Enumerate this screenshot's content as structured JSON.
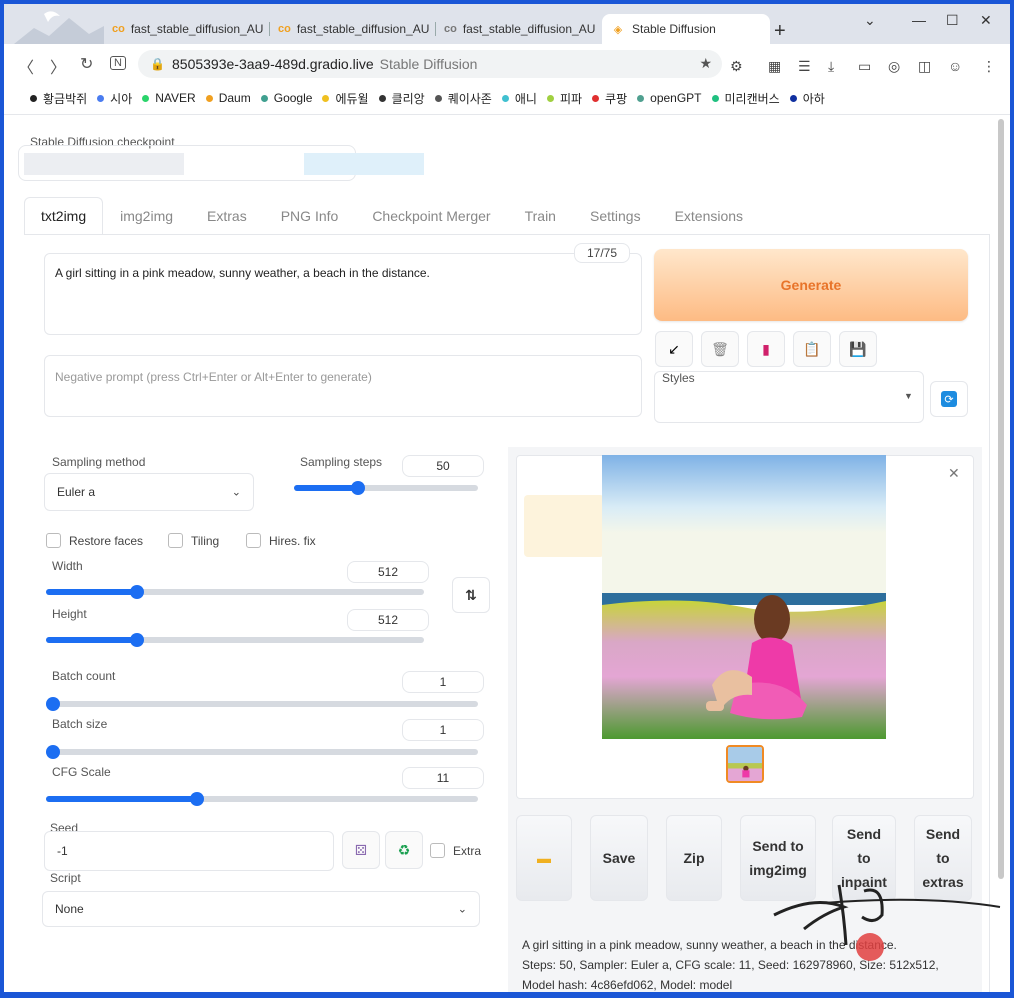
{
  "browser": {
    "tabs": [
      {
        "title": "fast_stable_diffusion_AU",
        "icon": "colab-icon"
      },
      {
        "title": "fast_stable_diffusion_AU",
        "icon": "colab-icon"
      },
      {
        "title": "fast_stable_diffusion_AU",
        "icon": "colab-icon"
      },
      {
        "title": "Stable Diffusion",
        "icon": "gradio-icon",
        "active": true
      }
    ],
    "new_tab": "+",
    "url": "8505393e-3aa9-489d.gradio.live",
    "page_title": "Stable Diffusion",
    "bookmarks": [
      {
        "label": "황금박쥐",
        "color": "#222222"
      },
      {
        "label": "시아",
        "color": "#4a7cf0"
      },
      {
        "label": "NAVER",
        "color": "#2bd46b"
      },
      {
        "label": "Daum",
        "color": "#f0a020"
      },
      {
        "label": "Google",
        "color": "#40a090"
      },
      {
        "label": "에듀윌",
        "color": "#f0c020"
      },
      {
        "label": "클리앙",
        "color": "#333333"
      },
      {
        "label": "퀘이사존",
        "color": "#555555"
      },
      {
        "label": "애니",
        "color": "#40c0d0"
      },
      {
        "label": "피파",
        "color": "#a0d040"
      },
      {
        "label": "쿠팡",
        "color": "#e03030"
      },
      {
        "label": "openGPT",
        "color": "#50a090"
      },
      {
        "label": "미리캔버스",
        "color": "#20c080"
      },
      {
        "label": "아하",
        "color": "#1030a0"
      }
    ]
  },
  "checkpoint": {
    "label": "Stable Diffusion checkpoint"
  },
  "main_tabs": [
    {
      "label": "txt2img",
      "active": true
    },
    {
      "label": "img2img"
    },
    {
      "label": "Extras"
    },
    {
      "label": "PNG Info"
    },
    {
      "label": "Checkpoint Merger"
    },
    {
      "label": "Train"
    },
    {
      "label": "Settings"
    },
    {
      "label": "Extensions"
    }
  ],
  "prompt": {
    "value": "A girl sitting in a pink meadow, sunny weather, a beach in the distance.",
    "token_count": "17/75",
    "negative_placeholder": "Negative prompt (press Ctrl+Enter or Alt+Enter to generate)"
  },
  "generate": {
    "label": "Generate"
  },
  "styles": {
    "label": "Styles"
  },
  "params": {
    "sampling_method": {
      "label": "Sampling method",
      "value": "Euler a"
    },
    "sampling_steps": {
      "label": "Sampling steps",
      "value": "50",
      "fraction": 0.35
    },
    "checkboxes": [
      "Restore faces",
      "Tiling",
      "Hires. fix"
    ],
    "width": {
      "label": "Width",
      "value": "512",
      "fraction": 0.24
    },
    "height": {
      "label": "Height",
      "value": "512",
      "fraction": 0.24
    },
    "batch_count": {
      "label": "Batch count",
      "value": "1",
      "fraction": 0.0
    },
    "batch_size": {
      "label": "Batch size",
      "value": "1",
      "fraction": 0.0
    },
    "cfg_scale": {
      "label": "CFG Scale",
      "value": "11",
      "fraction": 0.35
    },
    "seed": {
      "label": "Seed",
      "value": "-1",
      "extra_label": "Extra"
    },
    "script": {
      "label": "Script",
      "value": "None"
    }
  },
  "actions": [
    {
      "label": "",
      "icon": "folder-icon"
    },
    {
      "label": "Save"
    },
    {
      "label": "Zip"
    },
    {
      "label": "Send to img2img"
    },
    {
      "label": "Send to inpaint"
    },
    {
      "label": "Send to extras"
    }
  ],
  "info": {
    "line1": "A girl sitting in a pink meadow, sunny weather, a beach in the distance.",
    "line2": "Steps: 50, Sampler: Euler a, CFG scale: 11, Seed: 162978960, Size: 512x512,",
    "line3": "Model hash: 4c86efd062, Model: model"
  },
  "colors": {
    "accent": "#1c6ef2",
    "generate_text": "#e8742a",
    "generate_bg": "#fdbb84"
  }
}
